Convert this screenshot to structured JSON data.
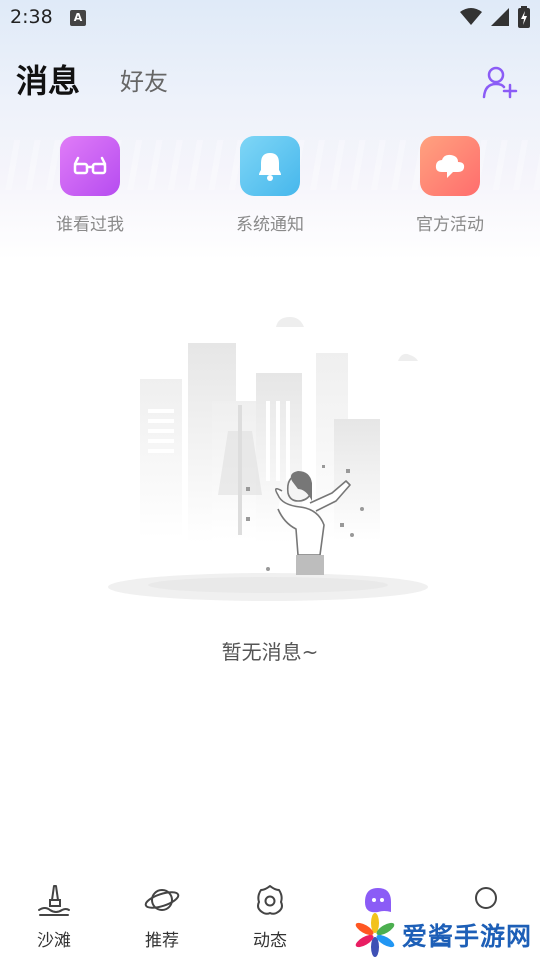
{
  "status_bar": {
    "time": "2:38",
    "notification_letter": "A"
  },
  "header": {
    "tab_messages": "消息",
    "tab_friends": "好友"
  },
  "quick_actions": [
    {
      "label": "谁看过我",
      "icon": "glasses-icon",
      "color": "#c95cf3"
    },
    {
      "label": "系统通知",
      "icon": "bell-icon",
      "color": "#5bc6f0"
    },
    {
      "label": "官方活动",
      "icon": "cloud-icon",
      "color": "#ff7a6a"
    }
  ],
  "empty_state": {
    "text": "暂无消息~"
  },
  "tabbar": {
    "items": [
      {
        "label": "沙滩",
        "icon": "beach-icon"
      },
      {
        "label": "推荐",
        "icon": "planet-icon"
      },
      {
        "label": "动态",
        "icon": "flower-icon"
      },
      {
        "label": "",
        "icon": "chat-bubble-icon"
      },
      {
        "label": "",
        "icon": "profile-circle-icon"
      }
    ]
  },
  "watermark": {
    "text": "爱酱手游网"
  },
  "colors": {
    "accent": "#8b5cf6",
    "watermark": "#1d5fb7"
  }
}
